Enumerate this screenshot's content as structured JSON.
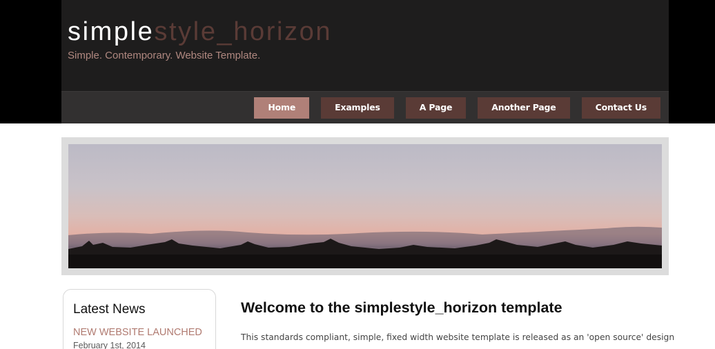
{
  "header": {
    "logo_part1": "simple",
    "logo_part2": "style_horizon",
    "slogan": "Simple. Contemporary. Website Template."
  },
  "menu": {
    "items": [
      {
        "label": "Home",
        "selected": true
      },
      {
        "label": "Examples",
        "selected": false
      },
      {
        "label": "A Page",
        "selected": false
      },
      {
        "label": "Another Page",
        "selected": false
      },
      {
        "label": "Contact Us",
        "selected": false
      }
    ]
  },
  "sidebar": {
    "heading": "Latest News",
    "news": [
      {
        "title": "NEW WEBSITE LAUNCHED",
        "date": "February 1st, 2014"
      }
    ]
  },
  "content": {
    "title": "Welcome to the simplestyle_horizon template",
    "intro": "This standards compliant, simple, fixed width website template is released as an 'open source' design"
  },
  "colors": {
    "accent": "#5a3b36",
    "accent_selected": "#b08078",
    "slogan": "#b08880",
    "news_title": "#b07a70"
  }
}
